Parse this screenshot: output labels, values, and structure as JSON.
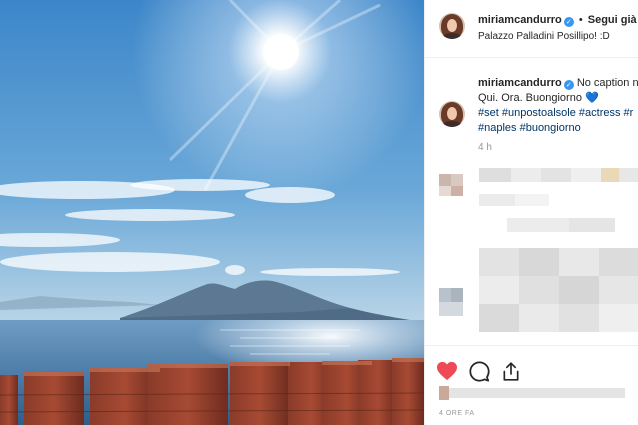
{
  "post": {
    "username": "miriamcandurro",
    "verified_mark": "✓",
    "separator": "•",
    "follow_label": "Segui già",
    "location": "Palazzo Palladini Posillipo! :D",
    "caption_text": "No caption n",
    "caption_line2": "Qui. Ora. Buongiorno",
    "caption_emoji": "💙",
    "hashtags_line1": "#set #unpostoalsole #actress #r",
    "hashtags_line2": "#naples #buongiorno",
    "time_ago": "4 h",
    "date_label": "4 ORE FA"
  },
  "actions": {
    "like_icon": "heart-filled-icon",
    "comment_icon": "comment-icon",
    "share_icon": "share-icon",
    "like_color": "#ed4956"
  },
  "photo": {
    "subject": "sun-sky-sea-vesuvius-icon"
  }
}
